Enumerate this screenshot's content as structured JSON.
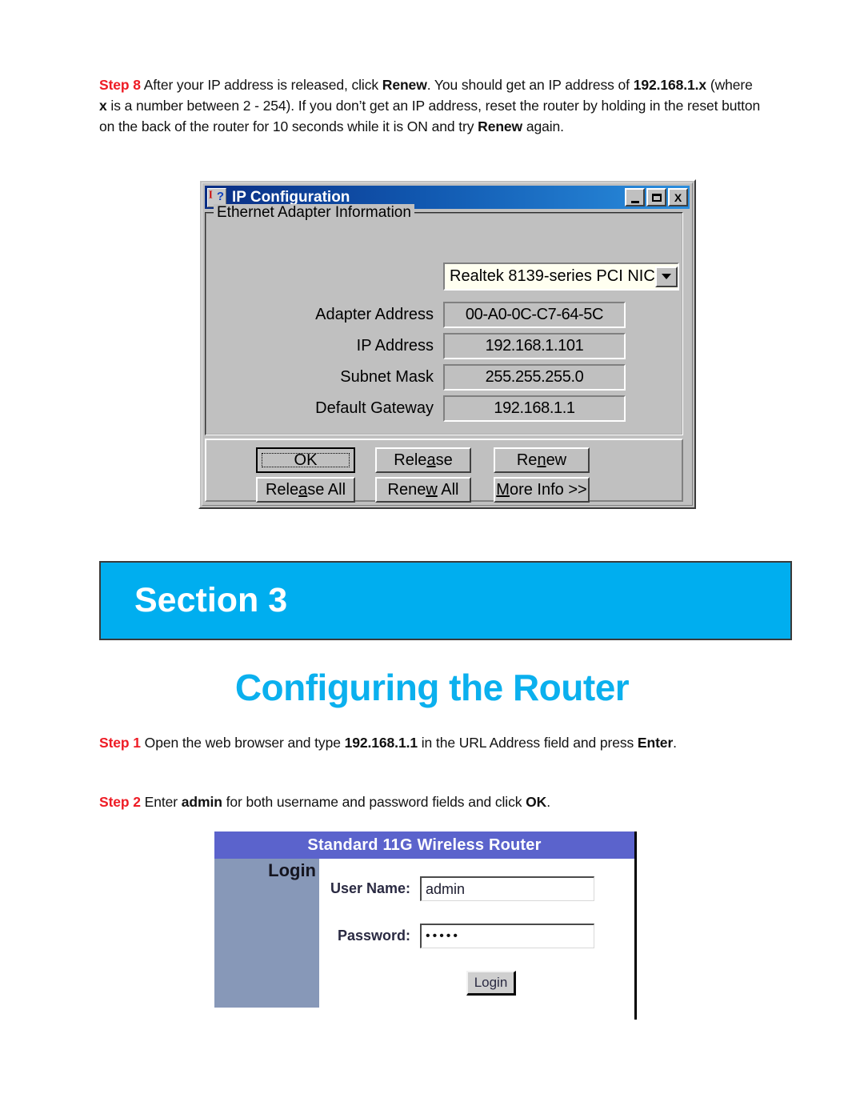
{
  "step8": {
    "label": "Step 8",
    "line1_a": " After your IP address is released, click ",
    "line1_b": "Renew",
    "line1_c": ". You should get an IP address of ",
    "line2_a": "192.168.1.x",
    "line2_b": " (where ",
    "line2_c": "x",
    "line2_d": " is a number between 2 - 254). If you don’t get an IP address, reset the router by holding in the reset button on the back of the router for 10 seconds while it is ON and try ",
    "line2_e": "Renew",
    "line2_f": " again."
  },
  "ip_config_dialog": {
    "title": "IP Configuration",
    "icon": "ip-question-icon",
    "titlebar_buttons": {
      "minimize": "minimize-button",
      "maximize": "maximize-button",
      "close": "X"
    },
    "groupbox_title": "Ethernet  Adapter Information",
    "adapter_select": {
      "value": "Realtek 8139-series PCI NIC",
      "arrow": "chevron-down-icon"
    },
    "fields": [
      {
        "label": "Adapter Address",
        "value": "00-A0-0C-C7-64-5C"
      },
      {
        "label": "IP Address",
        "value": "192.168.1.101"
      },
      {
        "label": "Subnet Mask",
        "value": "255.255.255.0"
      },
      {
        "label": "Default Gateway",
        "value": "192.168.1.1"
      }
    ],
    "buttons": [
      {
        "id": "ok",
        "pre": "",
        "mn": "",
        "post": "OK",
        "default": true
      },
      {
        "id": "release",
        "pre": "Rele",
        "mn": "a",
        "post": "se",
        "default": false
      },
      {
        "id": "renew",
        "pre": "Re",
        "mn": "n",
        "post": "ew",
        "default": false
      },
      {
        "id": "release-all",
        "pre": "Rele",
        "mn": "a",
        "post": "se All",
        "default": false
      },
      {
        "id": "renew-all",
        "pre": "Rene",
        "mn": "w",
        "post": " All",
        "default": false
      },
      {
        "id": "more-info",
        "pre": "",
        "mn": "M",
        "post": "ore Info >>",
        "default": false
      }
    ]
  },
  "section": {
    "banner_text": "Section 3",
    "title": "Configuring the Router",
    "banner_color": "#00aeef",
    "title_color": "#0bb0ee"
  },
  "step1": {
    "label": "Step 1",
    "a": " Open the web browser and type ",
    "b": "192.168.1.1",
    "c": " in the URL Address field and press ",
    "d": "Enter",
    "e": "."
  },
  "step2": {
    "label": "Step 2",
    "a": " Enter ",
    "b": "admin",
    "c": " for both username and password fields and click ",
    "d": "OK",
    "e": "."
  },
  "router_login": {
    "header": "Standard 11G Wireless Router",
    "sidebar_label": "Login",
    "username_label": "User Name:",
    "username_value": "admin",
    "password_label": "Password:",
    "password_value": "•••••",
    "login_button": "Login",
    "header_color": "#5b63cc",
    "sidebar_color": "#8798b8"
  }
}
